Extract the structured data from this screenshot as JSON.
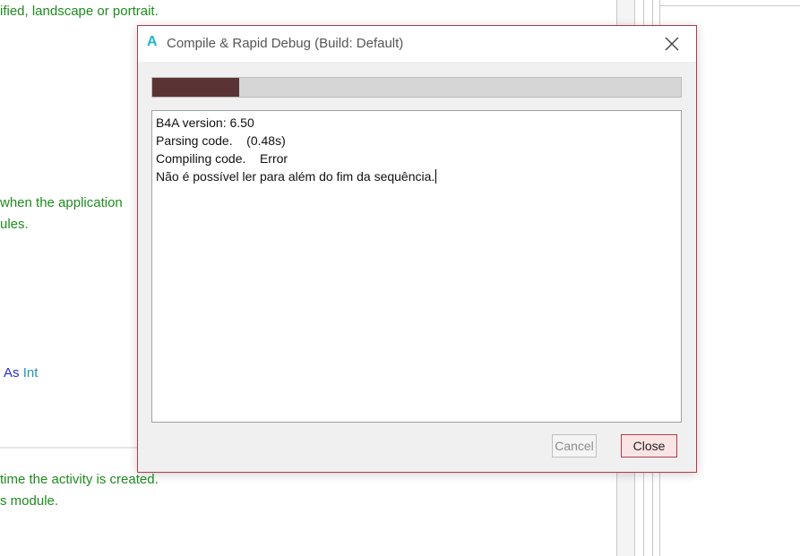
{
  "editor": {
    "line1": "ified, landscape or portrait.",
    "line2": "when the application",
    "line3": "ules.",
    "line4_as": "As",
    "line4_type": "Int",
    "line5": "time the activity is created.",
    "line6": "s module."
  },
  "dialog": {
    "app_icon": "A",
    "title": "Compile & Rapid Debug (Build: Default)",
    "close_icon": "close-icon",
    "progress_fraction": 0.165,
    "log": [
      "B4A version: 6.50",
      "Parsing code.    (0.48s)",
      "Compiling code.    Error",
      "Não é possível ler para além do fim da sequência."
    ],
    "cancel_label": "Cancel",
    "close_label": "Close"
  },
  "colors": {
    "accent_border": "#b33a4c",
    "progress_fill": "#5a3434",
    "code_comment": "#1e8c1e",
    "keyword": "#2a2ad0",
    "type": "#2b91af"
  }
}
